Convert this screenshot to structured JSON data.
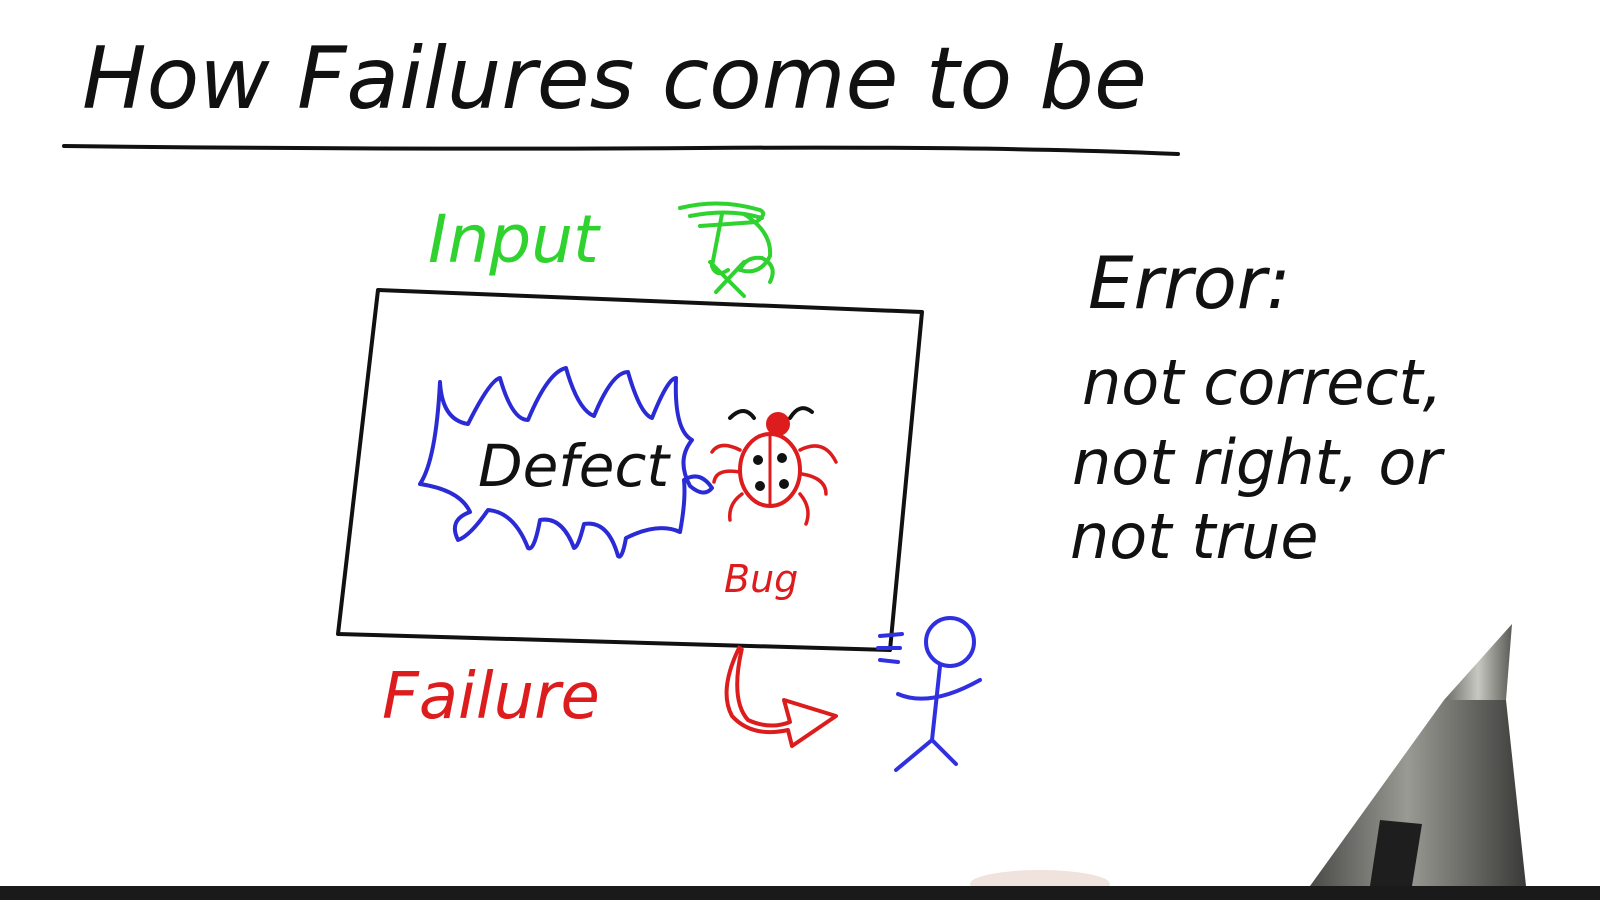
{
  "title": "How Failures come to be",
  "input_label": "Input",
  "defect_label": "Defect",
  "bug_label": "Bug",
  "failure_label": "Failure",
  "error_heading": "Error:",
  "error_definition": [
    "not correct,",
    "not right, or",
    "not true"
  ],
  "colors": {
    "ink": "#111111",
    "input": "#2fd22f",
    "defect_outline": "#2b2bd6",
    "bug": "#dd1d1d",
    "failure": "#dd1d1d",
    "person": "#3030e0",
    "background": "#ffffff"
  },
  "icons": {
    "bug": "ladybug-icon",
    "person": "stick-figure-icon",
    "pen": "stylus-pen-icon",
    "input_symbol": "scribble-input-icon"
  }
}
